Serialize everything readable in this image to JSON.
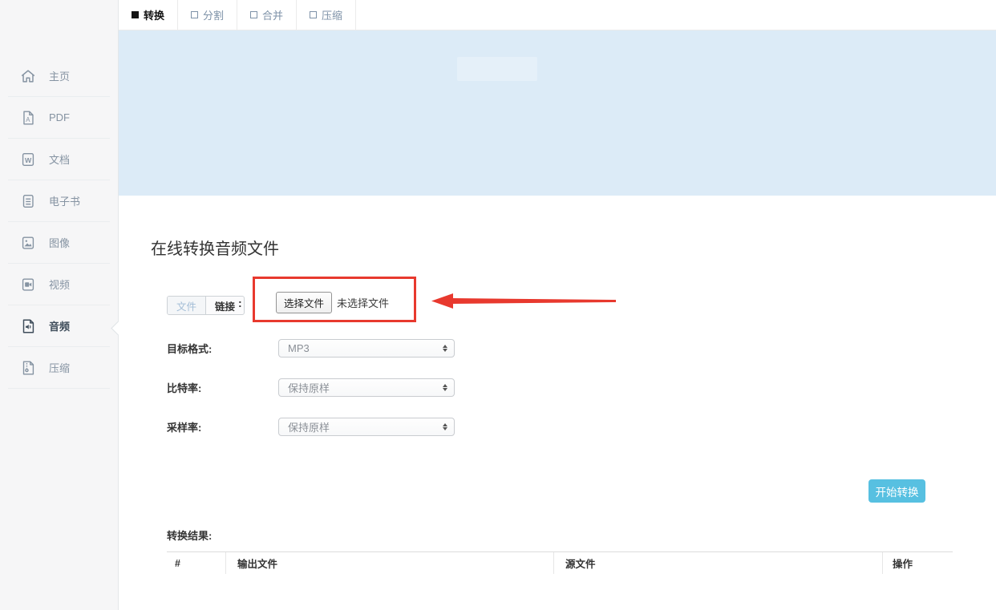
{
  "tabs": [
    {
      "label": "转换",
      "active": true
    },
    {
      "label": "分割",
      "active": false
    },
    {
      "label": "合并",
      "active": false
    },
    {
      "label": "压缩",
      "active": false
    }
  ],
  "sidebar": {
    "items": [
      {
        "label": "主页",
        "icon": "home-icon",
        "active": false
      },
      {
        "label": "PDF",
        "icon": "pdf-file-icon",
        "active": false
      },
      {
        "label": "文档",
        "icon": "word-doc-icon",
        "active": false
      },
      {
        "label": "电子书",
        "icon": "ebook-icon",
        "active": false
      },
      {
        "label": "图像",
        "icon": "image-icon",
        "active": false
      },
      {
        "label": "视频",
        "icon": "video-icon",
        "active": false
      },
      {
        "label": "音频",
        "icon": "audio-icon",
        "active": true
      },
      {
        "label": "压缩",
        "icon": "archive-icon",
        "active": false
      }
    ]
  },
  "main": {
    "title": "在线转换音频文件",
    "source_toggle": {
      "file_label": "文件",
      "link_label": "链接",
      "colon": ":"
    },
    "file_input": {
      "button_label": "选择文件",
      "status_text": "未选择文件"
    },
    "fields": [
      {
        "label": "目标格式:",
        "value": "MP3"
      },
      {
        "label": "比特率:",
        "value": "保持原样"
      },
      {
        "label": "采样率:",
        "value": "保持原样"
      }
    ],
    "convert_button": "开始转换",
    "results": {
      "label": "转换结果:",
      "columns": [
        "#",
        "输出文件",
        "源文件",
        "操作"
      ]
    }
  },
  "colors": {
    "banner_blue": "#dcebf7",
    "highlight_red": "#e8392e",
    "button_blue": "#57c0e1",
    "sidebar_bg": "#f6f6f7",
    "inactive_text": "#8593a2",
    "active_text": "#3e4c5a"
  }
}
